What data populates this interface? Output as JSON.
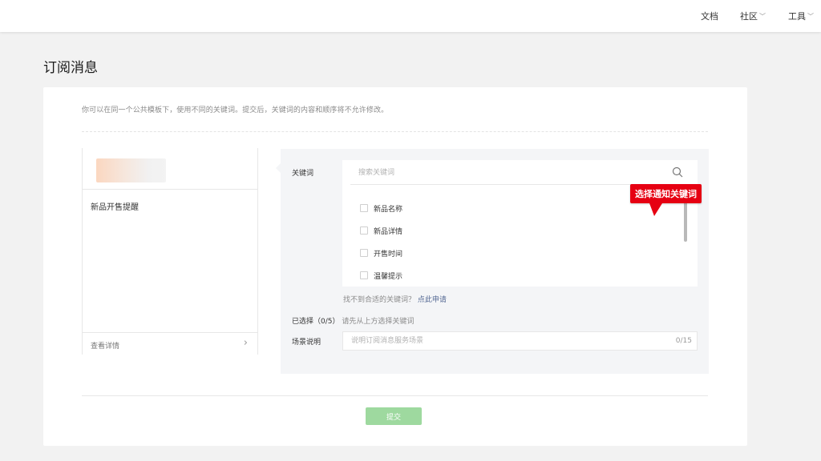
{
  "topbar": {
    "docs": "文档",
    "community": "社区",
    "tools": "工具"
  },
  "page": {
    "title": "订阅消息"
  },
  "intro": "你可以在同一个公共模板下，使用不同的关键词。提交后，关键词的内容和顺序将不允许修改。",
  "preview": {
    "template_name": "新品开售提醒",
    "detail_label": "查看详情"
  },
  "keywords": {
    "label": "关键词",
    "search_placeholder": "搜索关键词",
    "items": [
      "新品名称",
      "新品详情",
      "开售时间",
      "温馨提示"
    ],
    "missing_text": "找不到合适的关键词？",
    "missing_link": "点此申请"
  },
  "tooltip": "选择通知关键词",
  "selection": {
    "label": "已选择（0/5）",
    "hint": "请先从上方选择关键词"
  },
  "scene": {
    "label": "场景说明",
    "placeholder": "说明订阅消息服务场景",
    "counter": "0/15"
  },
  "submit_label": "提交",
  "colors": {
    "tooltip": "#e60012",
    "submit_disabled": "#9ed99f",
    "link": "#576b95"
  }
}
